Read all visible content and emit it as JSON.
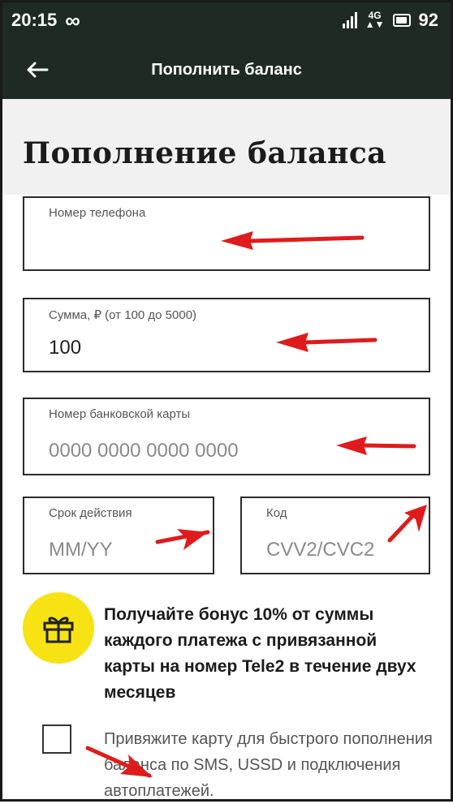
{
  "status_bar": {
    "time": "20:15",
    "battery": "92"
  },
  "app_bar": {
    "title": "Пополнить баланс"
  },
  "page": {
    "heading": "Пополнение баланса"
  },
  "form": {
    "phone": {
      "label": "Номер телефона",
      "value": ""
    },
    "amount": {
      "label": "Сумма, ₽ (от 100 до 5000)",
      "value": "100"
    },
    "card": {
      "label": "Номер банковской карты",
      "placeholder": "0000 0000 0000 0000"
    },
    "expiry": {
      "label": "Срок действия",
      "placeholder": "MM/YY"
    },
    "cvv": {
      "label": "Код",
      "placeholder": "CVV2/CVC2"
    }
  },
  "bonus": {
    "text": "Получайте бонус 10% от суммы каждого платежа с привязанной карты на номер Tele2 в течение двух месяцев"
  },
  "consent": {
    "text": "Привяжите карту для быстрого пополнения баланса по SMS, USSD и подключения автоплатежей."
  },
  "icons": {
    "back": "arrow-left-icon",
    "gift": "gift-icon",
    "infinity": "infinity-icon",
    "signal": "signal-icon",
    "network": "network-4g-icon",
    "battery": "battery-icon"
  },
  "colors": {
    "header_bg": "#1e2a23",
    "gift_circle": "#f7e214",
    "annotation_arrow": "#e01b1b"
  }
}
